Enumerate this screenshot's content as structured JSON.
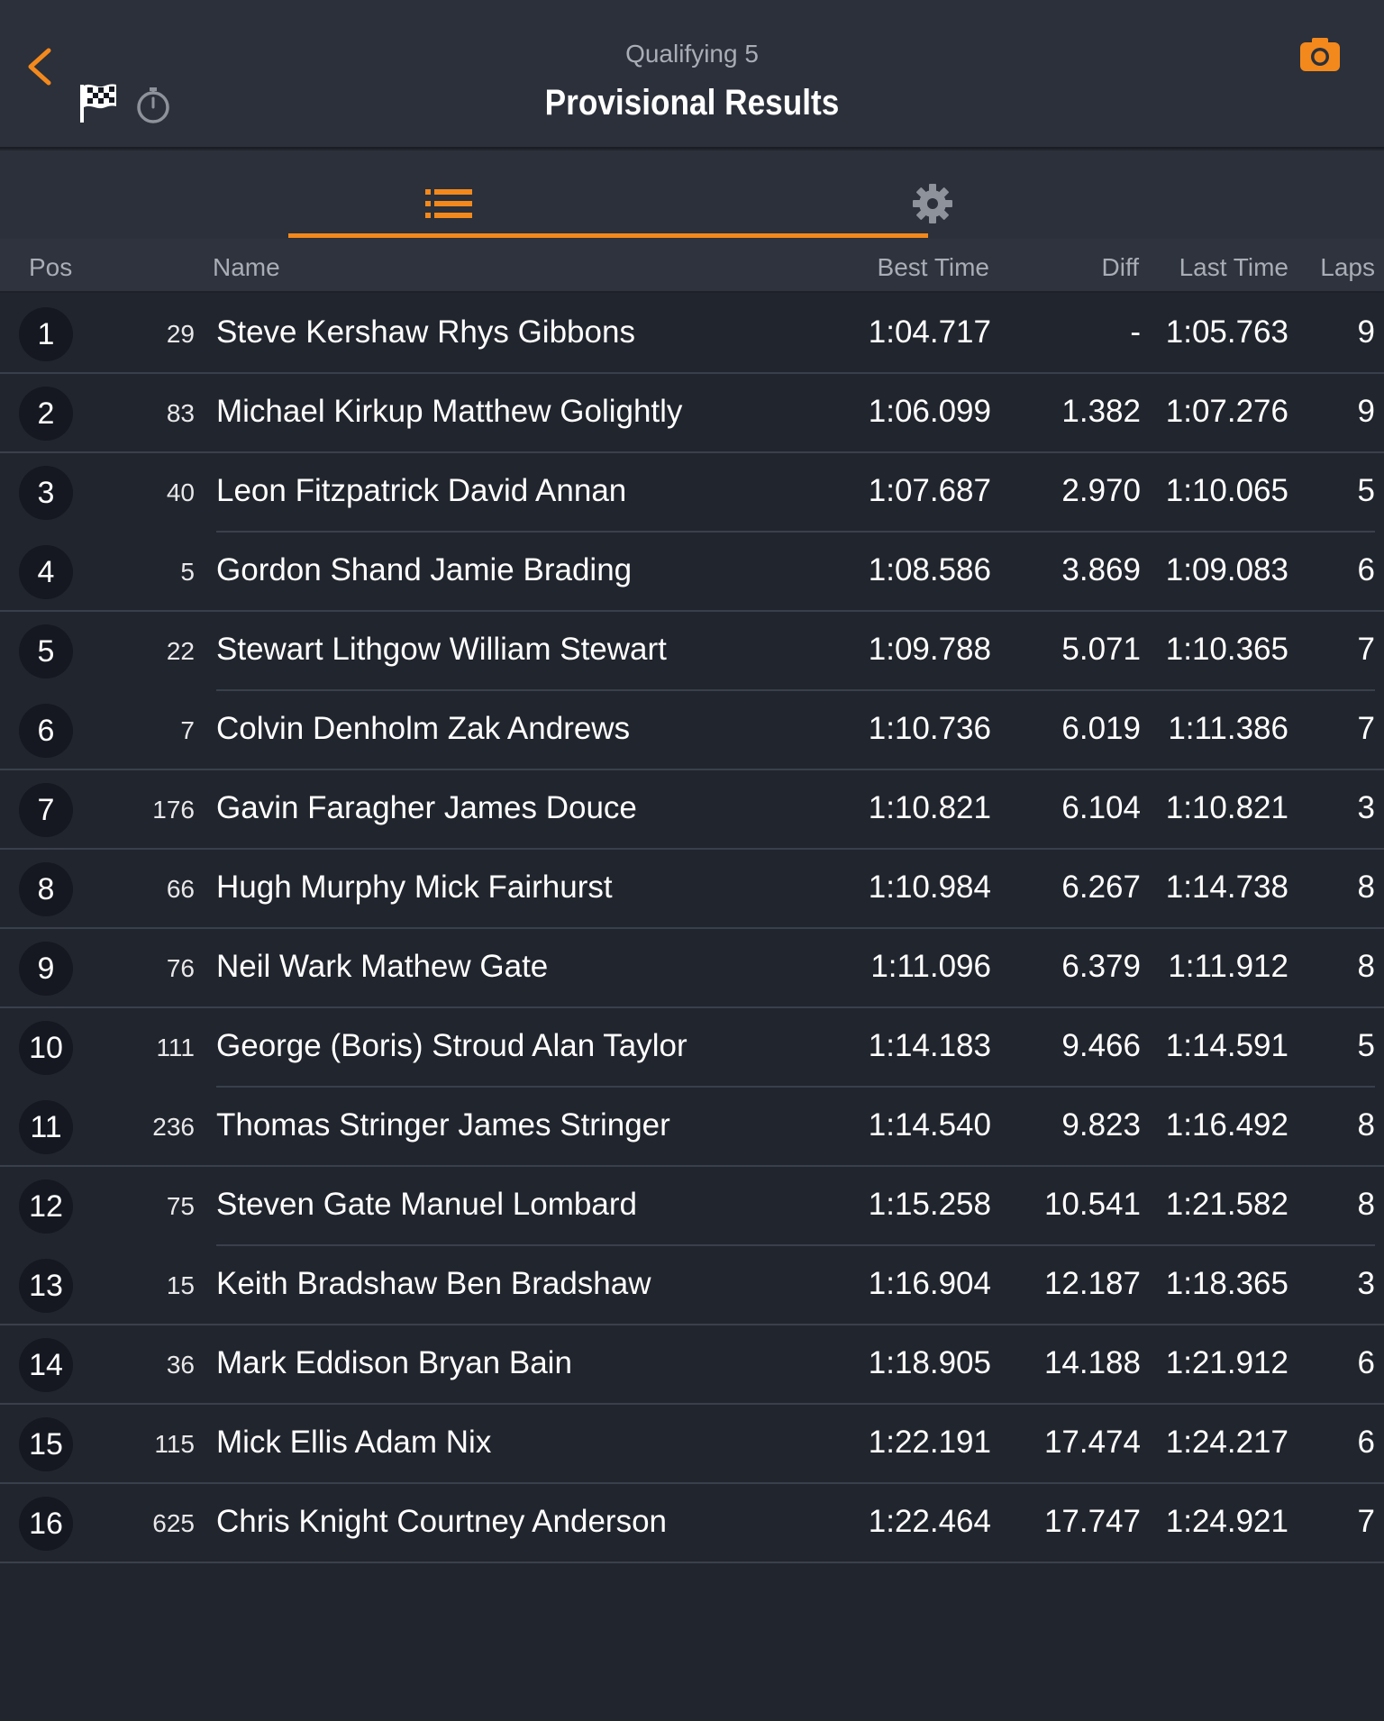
{
  "header": {
    "subtitle": "Qualifying 5",
    "title": "Provisional Results",
    "icons": [
      "chevron-left-icon",
      "checkered-flag-icon",
      "stopwatch-icon",
      "camera-icon"
    ],
    "accent_color": "#f3891c"
  },
  "tabs": [
    {
      "icon": "list-icon",
      "active": true
    },
    {
      "icon": "gear-icon",
      "active": false
    }
  ],
  "columns": {
    "pos": "Pos",
    "name": "Name",
    "best": "Best Time",
    "diff": "Diff",
    "last": "Last Time",
    "laps": "Laps"
  },
  "rows": [
    {
      "pos": "1",
      "num": "29",
      "name": "Steve Kershaw Rhys Gibbons",
      "best": "1:04.717",
      "diff": "-",
      "last": "1:05.763",
      "laps": "9"
    },
    {
      "pos": "2",
      "num": "83",
      "name": "Michael Kirkup Matthew Golightly",
      "best": "1:06.099",
      "diff": "1.382",
      "last": "1:07.276",
      "laps": "9"
    },
    {
      "pos": "3",
      "num": "40",
      "name": "Leon Fitzpatrick David Annan",
      "best": "1:07.687",
      "diff": "2.970",
      "last": "1:10.065",
      "laps": "5"
    },
    {
      "pos": "4",
      "num": "5",
      "name": "Gordon Shand Jamie Brading",
      "best": "1:08.586",
      "diff": "3.869",
      "last": "1:09.083",
      "laps": "6"
    },
    {
      "pos": "5",
      "num": "22",
      "name": "Stewart Lithgow William Stewart",
      "best": "1:09.788",
      "diff": "5.071",
      "last": "1:10.365",
      "laps": "7"
    },
    {
      "pos": "6",
      "num": "7",
      "name": "Colvin Denholm Zak Andrews",
      "best": "1:10.736",
      "diff": "6.019",
      "last": "1:11.386",
      "laps": "7"
    },
    {
      "pos": "7",
      "num": "176",
      "name": "Gavin Faragher James Douce",
      "best": "1:10.821",
      "diff": "6.104",
      "last": "1:10.821",
      "laps": "3"
    },
    {
      "pos": "8",
      "num": "66",
      "name": "Hugh Murphy Mick Fairhurst",
      "best": "1:10.984",
      "diff": "6.267",
      "last": "1:14.738",
      "laps": "8"
    },
    {
      "pos": "9",
      "num": "76",
      "name": "Neil Wark Mathew Gate",
      "best": "1:11.096",
      "diff": "6.379",
      "last": "1:11.912",
      "laps": "8"
    },
    {
      "pos": "10",
      "num": "111",
      "name": "George (Boris) Stroud Alan Taylor",
      "best": "1:14.183",
      "diff": "9.466",
      "last": "1:14.591",
      "laps": "5"
    },
    {
      "pos": "11",
      "num": "236",
      "name": "Thomas Stringer James Stringer",
      "best": "1:14.540",
      "diff": "9.823",
      "last": "1:16.492",
      "laps": "8"
    },
    {
      "pos": "12",
      "num": "75",
      "name": "Steven Gate Manuel Lombard",
      "best": "1:15.258",
      "diff": "10.541",
      "last": "1:21.582",
      "laps": "8"
    },
    {
      "pos": "13",
      "num": "15",
      "name": "Keith Bradshaw Ben Bradshaw",
      "best": "1:16.904",
      "diff": "12.187",
      "last": "1:18.365",
      "laps": "3"
    },
    {
      "pos": "14",
      "num": "36",
      "name": "Mark Eddison Bryan Bain",
      "best": "1:18.905",
      "diff": "14.188",
      "last": "1:21.912",
      "laps": "6"
    },
    {
      "pos": "15",
      "num": "115",
      "name": "Mick Ellis Adam Nix",
      "best": "1:22.191",
      "diff": "17.474",
      "last": "1:24.217",
      "laps": "6"
    },
    {
      "pos": "16",
      "num": "625",
      "name": "Chris Knight Courtney Anderson",
      "best": "1:22.464",
      "diff": "17.747",
      "last": "1:24.921",
      "laps": "7"
    }
  ]
}
